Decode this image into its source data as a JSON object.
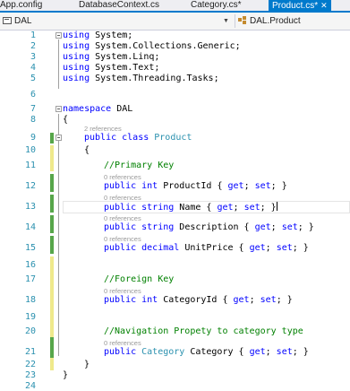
{
  "tabs": [
    {
      "label": "App.config",
      "active": false
    },
    {
      "label": "DatabaseContext.cs",
      "active": false
    },
    {
      "label": "Category.cs*",
      "active": false
    },
    {
      "label": "Product.cs*",
      "active": true,
      "close": "✕"
    }
  ],
  "nav": {
    "project": "DAL",
    "member": "DAL.Product",
    "dropdown_arrow": "▼"
  },
  "lens": {
    "two": "2 references",
    "zero": "0 references"
  },
  "lines": {
    "l1": {
      "num": "1",
      "kw": "using",
      "rest": " System;"
    },
    "l2": {
      "num": "2",
      "kw": "using",
      "rest": " System.Collections.Generic;"
    },
    "l3": {
      "num": "3",
      "kw": "using",
      "rest": " System.Linq;"
    },
    "l4": {
      "num": "4",
      "kw": "using",
      "rest": " System.Text;"
    },
    "l5": {
      "num": "5",
      "kw": "using",
      "rest": " System.Threading.Tasks;"
    },
    "l6": {
      "num": "6"
    },
    "l7": {
      "num": "7",
      "kw": "namespace",
      "rest": " DAL"
    },
    "l8": {
      "num": "8",
      "text": "{"
    },
    "l9": {
      "num": "9",
      "kw1": "public",
      "kw2": " class",
      "type": " Product"
    },
    "l10": {
      "num": "10",
      "text": "{"
    },
    "l11": {
      "num": "11",
      "comment": "//Primary Key"
    },
    "l12": {
      "num": "12",
      "kw1": "public",
      "kw2": " int",
      "name": " ProductId { ",
      "get": "get",
      "mid": "; ",
      "set": "set",
      "end": "; }"
    },
    "l13": {
      "num": "13",
      "kw1": "public",
      "kw2": " string",
      "name": " Name { ",
      "get": "get",
      "mid": "; ",
      "set": "set",
      "end": "; }"
    },
    "l14": {
      "num": "14",
      "kw1": "public",
      "kw2": " string",
      "name": " Description { ",
      "get": "get",
      "mid": "; ",
      "set": "set",
      "end": "; }"
    },
    "l15": {
      "num": "15",
      "kw1": "public",
      "kw2": " decimal",
      "name": " UnitPrice { ",
      "get": "get",
      "mid": "; ",
      "set": "set",
      "end": "; }"
    },
    "l16": {
      "num": "16"
    },
    "l17": {
      "num": "17",
      "comment": "//Foreign Key"
    },
    "l18": {
      "num": "18",
      "kw1": "public",
      "kw2": " int",
      "name": " CategoryId { ",
      "get": "get",
      "mid": "; ",
      "set": "set",
      "end": "; }"
    },
    "l19": {
      "num": "19"
    },
    "l20": {
      "num": "20",
      "comment": "//Navigation Propety to category type"
    },
    "l21": {
      "num": "21",
      "kw1": "public",
      "type": " Category",
      "name": " Category { ",
      "get": "get",
      "mid": "; ",
      "set": "set",
      "end": "; }"
    },
    "l22": {
      "num": "22",
      "text": "}"
    },
    "l23": {
      "num": "23",
      "text": "}"
    },
    "l24": {
      "num": "24"
    }
  },
  "colors": {
    "keyword": "#0000ff",
    "type": "#2b91af",
    "comment": "#008000",
    "line_number": "#2b91af",
    "active_tab": "#007acc",
    "saved_change_bar": "#57a64a",
    "unsaved_change_bar": "#efe98b"
  }
}
